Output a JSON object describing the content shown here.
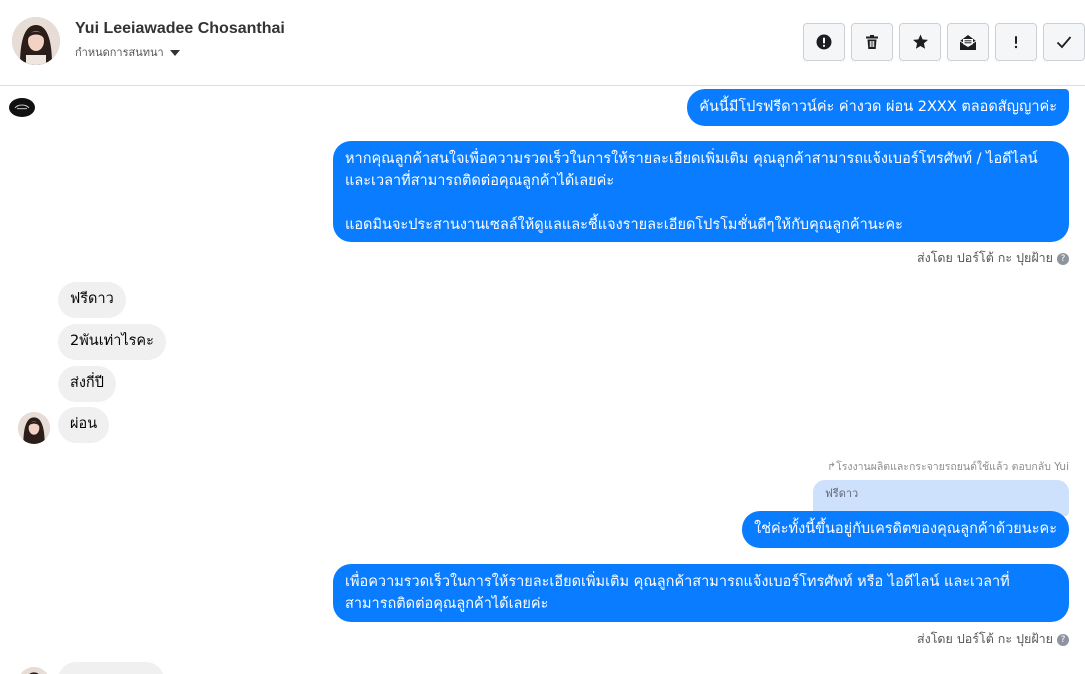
{
  "header": {
    "name": "Yui Leeiawadee Chosanthai",
    "subtitle": "กำหนดการสนทนา",
    "toolbar": {
      "colors": {
        "button_bg": "#f5f6f7",
        "border": "#ccd0d5",
        "icon": "#333333"
      },
      "buttons": [
        {
          "icon": "alert-circle-icon"
        },
        {
          "icon": "trash-icon"
        },
        {
          "icon": "star-icon"
        },
        {
          "icon": "mail-open-icon"
        },
        {
          "icon": "exclamation-icon"
        },
        {
          "icon": "check-icon"
        }
      ]
    }
  },
  "colors": {
    "outgoing": "#0a7cff",
    "incoming": "#f0f0f0",
    "quoted": "#cde1fc"
  },
  "messages": {
    "out1": "คันนี้มีโปรฟรีดาวน์ค่ะ ค่างวด ผ่อน 2XXX ตลอดสัญญาค่ะ",
    "out2": "หากคุณลูกค้าสนใจเพื่อความรวดเร็วในการให้รายละเอียดเพิ่มเติม คุณลูกค้าสามารถแจ้งเบอร์โทรศัพท์ / ไอดีไลน์ และเวลาที่สามารถติดต่อคุณลูกค้าได้เลยค่ะ\n\nแอดมินจะประสานงานเซลล์ให้ดูแลและชี้แจงรายละเอียดโปรโมชั่นดีๆให้กับคุณลูกค้านะคะ",
    "sent_by_1": "ส่งโดย ปอร์โต้ กะ ปุยฝ้าย",
    "in1": "ฟรีดาว",
    "in2": "2พันเท่าไรคะ",
    "in3": "ส่งกี่ปี",
    "in4": "ผ่อน",
    "reply_label": "โรงงานผลิตและกระจายรถยนต์ใช้แล้ว ตอบกลับ Yui",
    "quoted": "ฟรีดาว",
    "out3": "ใช่ค่ะทั้งนี้ขึ้นอยู่กับเครดิตของคุณลูกค้าด้วยนะคะ",
    "out4": "เพื่อความรวดเร็วในการให้รายละเอียดเพิ่มเติม คุณลูกค้าสามารถแจ้งเบอร์โทรศัพท์ หรือ ไอดีไลน์ และเวลาที่สามารถติดต่อคุณลูกค้าได้เลยค่ะ",
    "sent_by_2": "ส่งโดย ปอร์โต้ กะ ปุยฝ้าย"
  }
}
